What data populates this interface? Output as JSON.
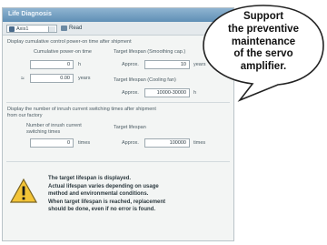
{
  "window": {
    "title": "Life Diagnosis"
  },
  "toolbar": {
    "axis_select": "Axis1",
    "read_button": "Read"
  },
  "section1": {
    "description": "Display cumulative control power-on time after shipment",
    "cumulative_label": "Cumulative power-on time",
    "cumulative_hours": "0",
    "hours_unit": "h",
    "approx_symbol": "≈",
    "cumulative_years": "0.00",
    "years_unit": "years",
    "target_smoothing_label": "Target lifespan (Smoothing cap.)",
    "approx_label_1": "Approx.",
    "target_smoothing_value": "10",
    "target_smoothing_unit": "years",
    "target_cooling_label": "Target lifespan (Cooling fan)",
    "approx_label_2": "Approx.",
    "target_cooling_value": "10000-30000",
    "target_cooling_unit": "h"
  },
  "section2": {
    "description_line1": "Display the number of inrush current switching times after shipment",
    "description_line2": "from our factory",
    "inrush_label_line1": "Number of inrush current",
    "inrush_label_line2": "switching times",
    "inrush_value": "0",
    "inrush_unit": "times",
    "target_label": "Target lifespan",
    "approx_label": "Approx.",
    "target_value": "100000",
    "target_unit": "times"
  },
  "warning": {
    "icon": "warning-triangle-icon",
    "line1": "The target lifespan is displayed.",
    "line2": "Actual lifespan varies depending on usage",
    "line3": "method and environmental conditions.",
    "line4": "When target lifespan is reached, replacement",
    "line5": "should be done, even if no error is found."
  },
  "callout": {
    "line1": "Support",
    "line2": "the preventive",
    "line3": "maintenance",
    "line4": "of the servo",
    "line5": "amplifier."
  }
}
